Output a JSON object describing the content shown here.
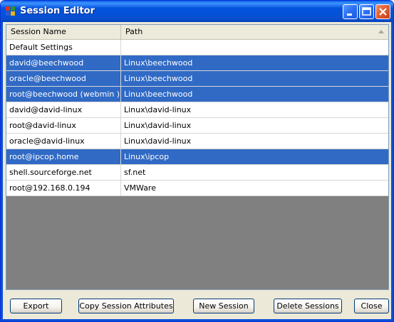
{
  "window": {
    "title": "Session Editor"
  },
  "table": {
    "columns": [
      "Session Name",
      "Path"
    ],
    "rows": [
      {
        "name": "Default Settings",
        "path": "",
        "selected": false
      },
      {
        "name": "david@beechwood",
        "path": "Linux\\beechwood",
        "selected": true
      },
      {
        "name": "oracle@beechwood",
        "path": "Linux\\beechwood",
        "selected": true
      },
      {
        "name": "root@beechwood (webmin )",
        "path": "Linux\\beechwood",
        "selected": true
      },
      {
        "name": "david@david-linux",
        "path": "Linux\\david-linux",
        "selected": false
      },
      {
        "name": "root@david-linux",
        "path": "Linux\\david-linux",
        "selected": false
      },
      {
        "name": "oracle@david-linux",
        "path": "Linux\\david-linux",
        "selected": false
      },
      {
        "name": "root@ipcop.home",
        "path": "Linux\\ipcop",
        "selected": true
      },
      {
        "name": "shell.sourceforge.net",
        "path": "sf.net",
        "selected": false
      },
      {
        "name": "root@192.168.0.194",
        "path": "VMWare",
        "selected": false
      }
    ]
  },
  "buttons": {
    "export": "Export",
    "copy_attributes": "Copy Session Attributes",
    "new_session": "New Session",
    "delete_sessions": "Delete Sessions",
    "close": "Close"
  },
  "colors": {
    "selection": "#316ac5",
    "titlebar": "#0553dd",
    "empty_area": "#808080"
  }
}
